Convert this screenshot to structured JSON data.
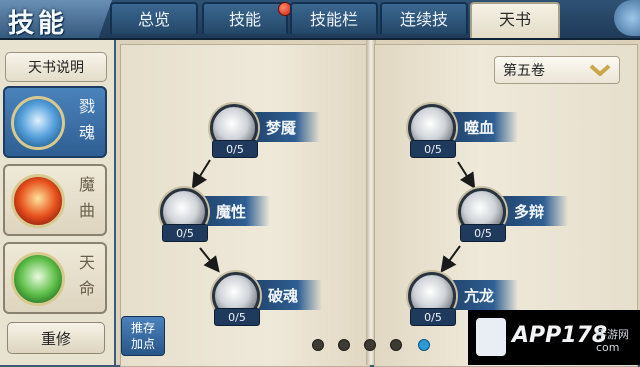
{
  "header": {
    "logo_text": "技能",
    "tabs": [
      {
        "label": "总览",
        "active": false,
        "has_alert": false
      },
      {
        "label": "技能",
        "active": false,
        "has_alert": true
      },
      {
        "label": "技能栏",
        "active": false,
        "has_alert": false
      },
      {
        "label": "连续技",
        "active": false,
        "has_alert": false
      },
      {
        "label": "天书",
        "active": true,
        "has_alert": false
      }
    ]
  },
  "sidebar": {
    "book_info_label": "天书说明",
    "categories": [
      {
        "label": "戮魂",
        "icon": "blue-beast-icon",
        "active": true
      },
      {
        "label": "魔曲",
        "icon": "red-beast-icon",
        "active": false
      },
      {
        "label": "天命",
        "icon": "green-beast-icon",
        "active": false
      }
    ],
    "reset_label": "重修"
  },
  "book": {
    "volume_label": "第五卷",
    "recommend_label_line1": "推存",
    "recommend_label_line2": "加点",
    "skills_left": [
      {
        "name": "梦魇",
        "level": "0/5"
      },
      {
        "name": "魔性",
        "level": "0/5"
      },
      {
        "name": "破魂",
        "level": "0/5"
      }
    ],
    "skills_right": [
      {
        "name": "噬血",
        "level": "0/5"
      },
      {
        "name": "多辩",
        "level": "0/5"
      },
      {
        "name": "亢龙",
        "level": "0/5"
      }
    ],
    "page_count": 5,
    "current_page": 5
  },
  "watermark": {
    "brand": "APP178",
    "sub": "手游网",
    "sub2": "com"
  },
  "colors": {
    "accent_blue": "#2f5f93",
    "active_dot": "#2b9bd8",
    "paper": "#efe9da"
  }
}
